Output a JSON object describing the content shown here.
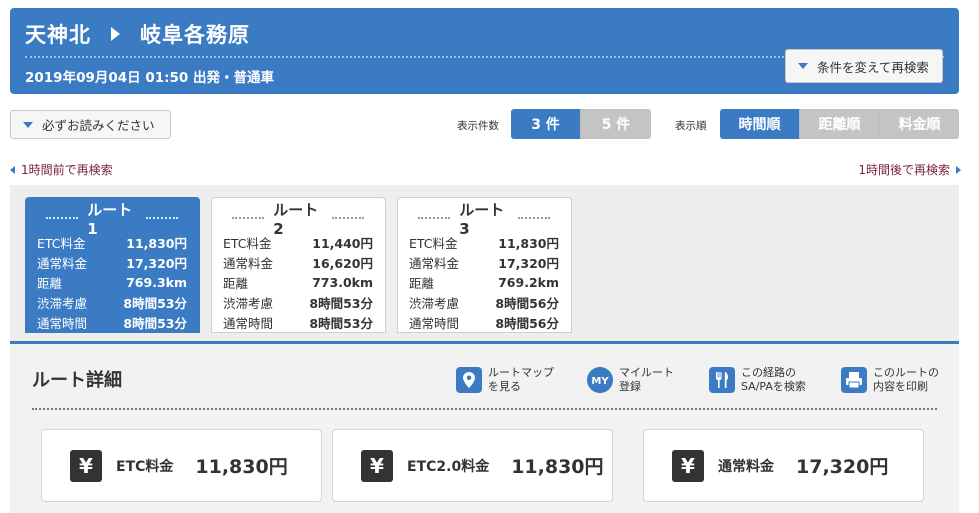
{
  "header": {
    "from": "天神北",
    "to": "岐阜各務原",
    "subtitle": "2019年09月04日 01:50 出発・普通車",
    "research_label": "条件を変えて再検索"
  },
  "controls": {
    "notice_label": "必ずお読みください",
    "count_label": "表示件数",
    "count_options": [
      "3 件",
      "5 件"
    ],
    "order_label": "表示順",
    "order_options": [
      "時間順",
      "距離順",
      "料金順"
    ]
  },
  "nav": {
    "prev": "1時間前で再検索",
    "next": "1時間後で再検索"
  },
  "routes": [
    {
      "title": "ルート1",
      "rows": [
        {
          "label": "ETC料金",
          "value": "11,830円"
        },
        {
          "label": "通常料金",
          "value": "17,320円"
        },
        {
          "label": "距離",
          "value": "769.3km"
        },
        {
          "label": "渋滞考慮",
          "value": "8時間53分"
        },
        {
          "label": "通常時間",
          "value": "8時間53分"
        }
      ]
    },
    {
      "title": "ルート2",
      "rows": [
        {
          "label": "ETC料金",
          "value": "11,440円"
        },
        {
          "label": "通常料金",
          "value": "16,620円"
        },
        {
          "label": "距離",
          "value": "773.0km"
        },
        {
          "label": "渋滞考慮",
          "value": "8時間53分"
        },
        {
          "label": "通常時間",
          "value": "8時間53分"
        }
      ]
    },
    {
      "title": "ルート3",
      "rows": [
        {
          "label": "ETC料金",
          "value": "11,830円"
        },
        {
          "label": "通常料金",
          "value": "17,320円"
        },
        {
          "label": "距離",
          "value": "769.2km"
        },
        {
          "label": "渋滞考慮",
          "value": "8時間56分"
        },
        {
          "label": "通常時間",
          "value": "8時間56分"
        }
      ]
    }
  ],
  "detail": {
    "title": "ルート詳細",
    "actions": [
      {
        "icon": "map-pin-icon",
        "line1": "ルートマップ",
        "line2": "を見る"
      },
      {
        "icon": "my-badge-icon",
        "badge": "MY",
        "line1": "マイルート",
        "line2": "登録"
      },
      {
        "icon": "fork-knife-icon",
        "line1": "この経路の",
        "line2": "SA/PAを検索"
      },
      {
        "icon": "printer-icon",
        "line1": "このルートの",
        "line2": "内容を印刷"
      }
    ],
    "fees": [
      {
        "symbol": "¥",
        "label": "ETC料金",
        "value": "11,830円"
      },
      {
        "symbol": "¥",
        "label": "ETC2.0料金",
        "value": "11,830円"
      },
      {
        "symbol": "¥",
        "label": "通常料金",
        "value": "17,320円"
      }
    ]
  },
  "colors": {
    "primary": "#3a7bc4",
    "link": "#7a1f3c",
    "segment_off": "#c4c4c4"
  }
}
